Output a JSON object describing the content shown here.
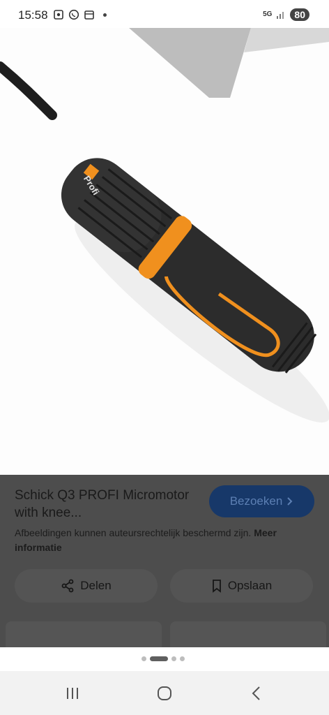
{
  "status_bar": {
    "time": "15:58",
    "network": "5G",
    "battery": "80"
  },
  "result": {
    "title": "Schick Q3 PROFI Micromotor with knee...",
    "visit_label": "Bezoeken",
    "copyright_text": "Afbeeldingen kunnen auteursrechtelijk beschermd zijn.",
    "more_info_label": "Meer informatie",
    "share_label": "Delen",
    "save_label": "Opslaan",
    "brand_text": "Profi"
  },
  "colors": {
    "accent_orange": "#f0901e",
    "visit_button": "#173869",
    "panel_dark": "#4d4d4d"
  },
  "icons": [
    "screenshot-icon",
    "whatsapp-icon",
    "calendar-icon",
    "signal-icon",
    "share-icon",
    "bookmark-icon",
    "chevron-right-icon",
    "recents-icon",
    "home-icon",
    "back-icon"
  ]
}
